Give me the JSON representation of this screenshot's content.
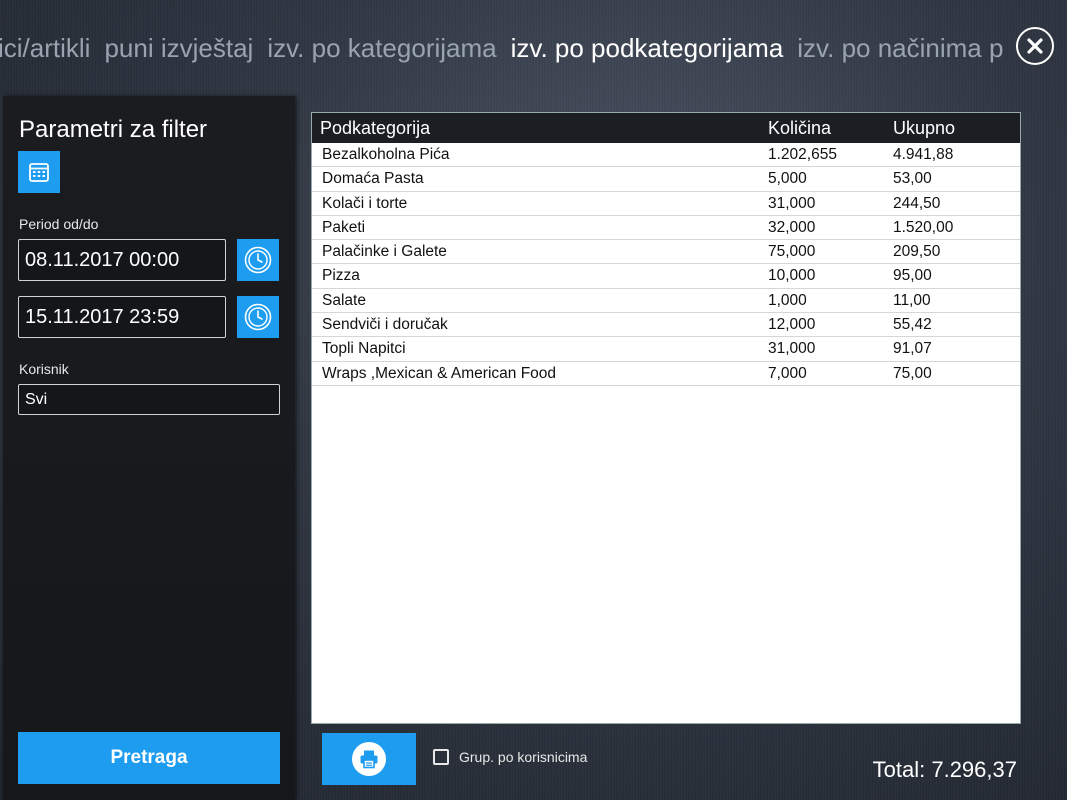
{
  "tabs": [
    {
      "label": "ici/artikli",
      "active": false
    },
    {
      "label": "puni izvještaj",
      "active": false
    },
    {
      "label": "izv. po kategorijama",
      "active": false
    },
    {
      "label": "izv. po podkategorijama",
      "active": true
    },
    {
      "label": "izv. po načinima p",
      "active": false
    }
  ],
  "close_icon": "close-icon",
  "filter": {
    "title": "Parametri za filter",
    "calendar_icon": "calendar-icon",
    "period_label": "Period od/do",
    "date_from": "08.11.2017 00:00",
    "date_to": "15.11.2017 23:59",
    "clock_icon": "clock-icon",
    "user_label": "Korisnik",
    "user_value": "Svi",
    "search_label": "Pretraga"
  },
  "table": {
    "headers": [
      "Podkategorija",
      "Količina",
      "Ukupno"
    ],
    "rows": [
      [
        "Bezalkoholna Pića",
        "1.202,655",
        "4.941,88"
      ],
      [
        "Domaća Pasta",
        "5,000",
        "53,00"
      ],
      [
        "Kolači i torte",
        "31,000",
        "244,50"
      ],
      [
        "Paketi",
        "32,000",
        "1.520,00"
      ],
      [
        "Palačinke i Galete",
        "75,000",
        "209,50"
      ],
      [
        "Pizza",
        "10,000",
        "95,00"
      ],
      [
        "Salate",
        "1,000",
        "11,00"
      ],
      [
        "Sendviči i doručak",
        "12,000",
        "55,42"
      ],
      [
        "Topli Napitci",
        "31,000",
        "91,07"
      ],
      [
        "Wraps ,Mexican & American Food",
        "7,000",
        "75,00"
      ]
    ]
  },
  "bottom": {
    "print_icon": "printer-icon",
    "group_label": "Grup. po korisnicima",
    "group_checked": false,
    "total": "Total: 7.296,37"
  },
  "colors": {
    "accent": "#1e9cf0",
    "panel": "#17191c"
  }
}
